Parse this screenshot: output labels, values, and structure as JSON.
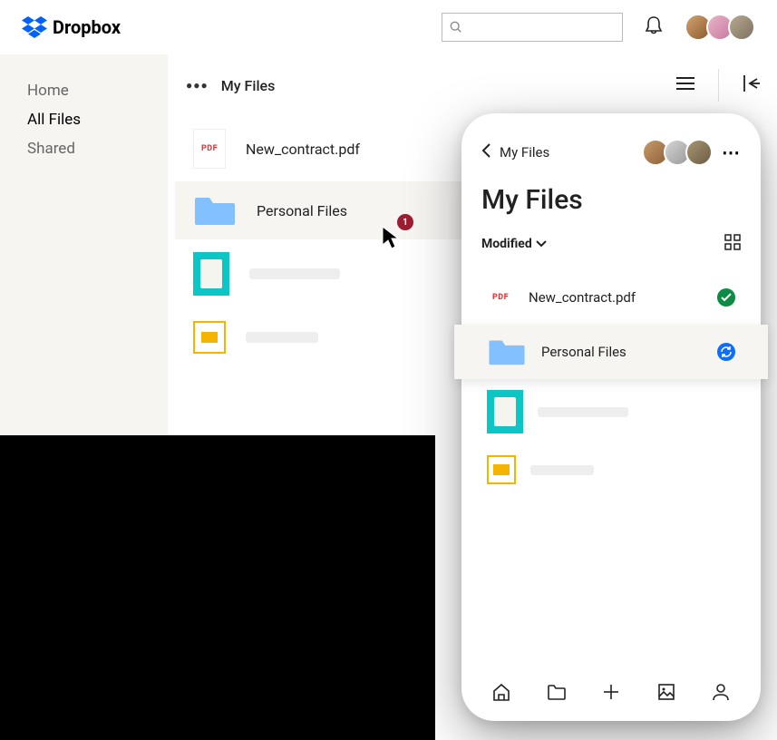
{
  "app_name": "Dropbox",
  "header": {
    "search_placeholder": ""
  },
  "sidebar": {
    "items": [
      {
        "label": "Home",
        "active": false
      },
      {
        "label": "All Files",
        "active": true
      },
      {
        "label": "Shared",
        "active": false
      }
    ]
  },
  "content": {
    "breadcrumb": "My Files",
    "files": [
      {
        "name": "New_contract.pdf",
        "type": "pdf"
      },
      {
        "name": "Personal Files",
        "type": "folder"
      },
      {
        "name": "",
        "type": "image_thumb"
      },
      {
        "name": "",
        "type": "slides"
      }
    ]
  },
  "cursor_badge": "1",
  "mobile": {
    "breadcrumb": "My Files",
    "title": "My Files",
    "sort": "Modified",
    "files": [
      {
        "name": "New_contract.pdf",
        "type": "pdf",
        "status": "synced"
      },
      {
        "name": "Personal Files",
        "type": "folder",
        "status": "syncing"
      },
      {
        "name": "",
        "type": "image_thumb"
      },
      {
        "name": "",
        "type": "slides"
      }
    ]
  },
  "icons": {
    "pdf": "PDF"
  }
}
